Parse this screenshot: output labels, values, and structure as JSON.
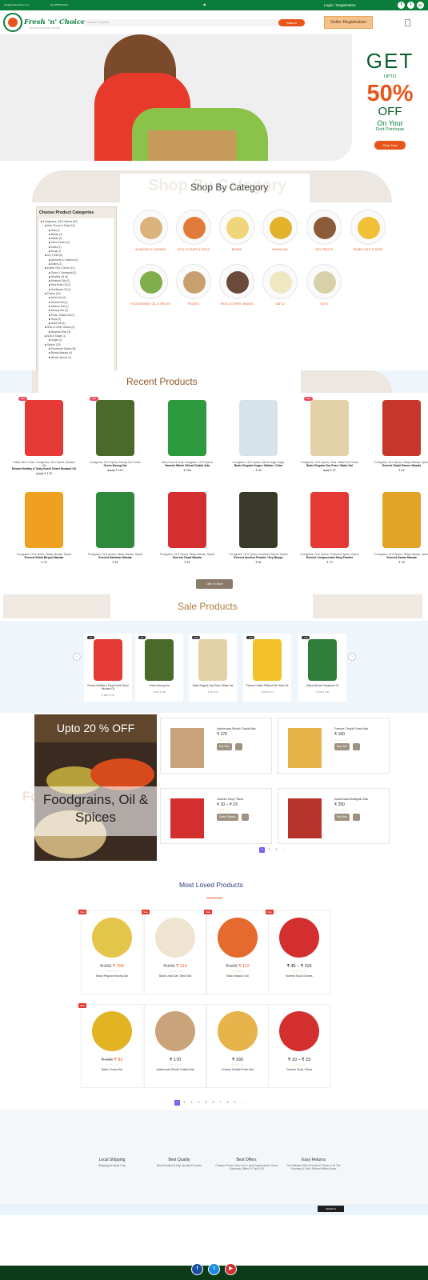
{
  "topbar": {
    "email": "info@freshnchoice.com",
    "phone": "+91 9876543210",
    "login_label": "Login / Registration",
    "social": [
      "f",
      "t",
      "G+"
    ]
  },
  "header": {
    "logo_name": "Fresh 'n' Choice",
    "logo_tagline": "ONLINE GROCERY STORE",
    "search_placeholder": "Search Products...",
    "search_button": "Search",
    "seller_button": "Seller Registration"
  },
  "hero": {
    "get": "GET",
    "upto": "UPTO",
    "percent": "50%",
    "off": "OFF",
    "on_your": "On Your",
    "first_purchase": "First Purchase",
    "shop_button": "Shop Now"
  },
  "category_section": {
    "ghost": "Shop By Category",
    "title": "Shop By Category",
    "sidebar_title": "Choose Product Categories",
    "tree": [
      "■ Foodgrains, Oil & Spices (67)",
      "  ■ Atta, Flours & Sooji (10)",
      "    ■ Atta (4)",
      "    ■ Besan (1)",
      "    ■ Maida (1)",
      "    ■ Other Flours (2)",
      "    ■ Sattu (1)",
      "    ■ Sooji (1)",
      "  ■ Dry Fruits (6)",
      "    ■ Almonds & Cashew (4)",
      "    ■ Dates (2)",
      "  ■ Edible Oils & Ghee (10)",
      "    ■ Ghee & Vanaspati (2)",
      "    ■ Healthy Oil (4)",
      "    ■ Mustard Oils (2)",
      "    ■ Rice Bran Oil (1)",
      "    ■ Sunflower Oil (1)",
      "  ■ Pulses (10)",
      "    ■ Arhar Dal (1)",
      "    ■ Chana Dal (1)",
      "    ■ Masoor Dal (1)",
      "    ■ Moong Dal (3)",
      "    ■ Peas / Matar Dal (1)",
      "    ■ Soya (2)",
      "    ■ Urad Dal (1)",
      "  ■ Rice & Other Grains (3)",
      "    ■ Basmati Rice (3)",
      "  ■ Salt & Sugar (1)",
      "    ■ Sugar (1)",
      "  ■ Spices (23)",
      "    ■ Powdered Spices (8)",
      "    ■ Ready Masala (4)",
      "    ■ Whole Spices (1)"
    ],
    "categories": [
      {
        "label": "ALMONDS & CASHEW",
        "color": "#d9b27c"
      },
      {
        "label": "ATTA, FLOURS & SOOJI",
        "color": "#e07a3a"
      },
      {
        "label": "BESAN",
        "color": "#f0d57a"
      },
      {
        "label": "CHANA DAL",
        "color": "#e3b12a"
      },
      {
        "label": "DRY FRUITS",
        "color": "#8a5a3a"
      },
      {
        "label": "EDIBLE OILS & GHEE",
        "color": "#f2c037"
      },
      {
        "label": "FOODGRAINS, OIL & SPICES",
        "color": "#7fae4a"
      },
      {
        "label": "PULSES",
        "color": "#c8a070"
      },
      {
        "label": "RICE & OTHER GRAINS",
        "color": "#6a4a3a"
      },
      {
        "label": "SATTU",
        "color": "#efe6c2"
      },
      {
        "label": "SOYA",
        "color": "#d8d0a8"
      }
    ]
  },
  "recent": {
    "title": "Recent Products",
    "click_more": "Click To More",
    "products": [
      {
        "badge": "Sale",
        "cat": "Edible Oils & Ghee, Foodgrains, Oil & Spices, Mustard Oils",
        "name": "Emami Healthy & Tasty Kachi Ghani Mustard Oil",
        "old": "₹ 180",
        "price": "₹ 175",
        "color": "#e53935"
      },
      {
        "badge": "Sale",
        "cat": "Foodgrains, Oil & Spices, Moong Dal, Pulses",
        "name": "Green Moong Dal",
        "old": "₹ 120",
        "price": "₹ 115",
        "color": "#4a6a2a"
      },
      {
        "badge": "",
        "cat": "Atta, Flours & Sooji, Foodgrains, Oil & Spices",
        "name": "Ganesh Whole Wheat Chakki Atta",
        "old": "",
        "price": "₹ 165",
        "color": "#2e9a3e"
      },
      {
        "badge": "",
        "cat": "Foodgrains, Oil & Spices, Salt & Sugar, Sugar",
        "name": "Basic Regular Sugar / Sakkar / Chini",
        "old": "",
        "price": "₹ 45",
        "color": "#d6e4ea"
      },
      {
        "badge": "Sale",
        "cat": "Foodgrains, Oil & Spices, Peas / Matar Dal, Pulses",
        "name": "Basic Regular Dry Peas / Matar Dal",
        "old": "₹ 45",
        "price": "₹ 37",
        "color": "#e3d2a8"
      },
      {
        "badge": "",
        "cat": "Foodgrains, Oil & Spices, Ready Masala, Spices",
        "name": "Everest Shahi Paneer Masala",
        "old": "",
        "price": "₹ 42",
        "color": "#c8352a"
      },
      {
        "badge": "",
        "cat": "Foodgrains, Oil & Spices, Ready Masala, Spices",
        "name": "Everest Shahi Biryani Masala",
        "old": "",
        "price": "₹ 70",
        "color": "#f0a020"
      },
      {
        "badge": "",
        "cat": "Foodgrains, Oil & Spices, Ready Masala, Spices",
        "name": "Everest Sambhar Masala",
        "old": "",
        "price": "₹ 63",
        "color": "#2e8a3a"
      },
      {
        "badge": "",
        "cat": "Foodgrains, Oil & Spices, Ready Masala, Spices",
        "name": "Everest Chaat Masala",
        "old": "",
        "price": "₹ 42",
        "color": "#d32f2f"
      },
      {
        "badge": "",
        "cat": "Foodgrains, Oil & Spices, Powdered Spices, Spices",
        "name": "Everest Amchur Powder / Dry Mango",
        "old": "",
        "price": "₹ 80",
        "color": "#3a3a2a"
      },
      {
        "badge": "",
        "cat": "Foodgrains, Oil & Spices, Powdered Spices, Spices",
        "name": "Everest Compounded Hing Powder",
        "old": "",
        "price": "₹ 70",
        "color": "#e53935"
      },
      {
        "badge": "",
        "cat": "Foodgrains, Oil & Spices, Ready Masala, Spices",
        "name": "Everest Garam Masala",
        "old": "",
        "price": "₹ 78",
        "color": "#e2a326"
      }
    ]
  },
  "sale": {
    "title": "Sale Products",
    "items": [
      {
        "badge": "-3%",
        "name": "Emami Healthy & Tasty Kachi Ghani Mustard Oil",
        "price": "₹ 180 ₹ 175",
        "color": "#e53935"
      },
      {
        "badge": "-4%",
        "name": "Green Moong Dal",
        "price": "₹ 120 ₹ 115",
        "color": "#4a6a2a"
      },
      {
        "badge": "-18%",
        "name": "Basic Regular Dry Peas / Matar Dal",
        "price": "₹ 45 ₹ 37",
        "color": "#e3d2a8"
      },
      {
        "badge": "-12%",
        "name": "Fortune Health Refined Rice Bran Oil",
        "price": "₹ 195 ₹ 171",
        "color": "#f3c12a"
      },
      {
        "badge": "-13%",
        "name": "King's Refined Soyabean Oil",
        "price": "₹ 150 ₹ 130",
        "color": "#2f7d3a"
      }
    ]
  },
  "promo": {
    "upto": "Upto 20 % OFF",
    "name": "Foodgrains, Oil & Spices",
    "ghost": "Fo",
    "products": [
      {
        "name": "Aashirvaad Shudh Chakki Atta",
        "price": "₹ 170",
        "button": "Buy Now",
        "color": "#c9a37a"
      },
      {
        "name": "Fortune Chakki Fresh Atta",
        "price": "₹ 160",
        "button": "Buy Now",
        "color": "#e6b44a"
      },
      {
        "name": "Ganesh Sooji / Rava",
        "price": "₹ 10 – ₹ 23",
        "button": "Select Options",
        "color": "#d32f2f"
      },
      {
        "name": "Aashirvaad Multigrain Atta",
        "price": "₹ 250",
        "button": "Buy Now",
        "color": "#b7342a"
      }
    ],
    "pages": [
      "1",
      "2",
      "3",
      "→"
    ]
  },
  "most_loved": {
    "title": "Most Loved Products",
    "products": [
      {
        "sale": "Sale",
        "old": "₹ 160",
        "price": "₹ 150",
        "name": "Basic Regular Moong Dal",
        "color": "#e3c54a"
      },
      {
        "sale": "Sale",
        "old": "₹ 140",
        "price": "₹ 115",
        "name": "Basic Urad Dal / Beuli Dal",
        "color": "#eee4d0"
      },
      {
        "sale": "Sale",
        "old": "₹ 120",
        "price": "₹ 112",
        "name": "Basic Masoor Dal",
        "color": "#e46a2e"
      },
      {
        "sale": "Sale",
        "old": "",
        "price": "₹ 45 – ₹ 115",
        "name": "Nutrela Soya Chunks",
        "color": "#d32f2f"
      },
      {
        "sale": "Sale",
        "old": "₹ 120",
        "price": "₹ 82",
        "name": "Basic Chana Dal",
        "color": "#e2b424"
      },
      {
        "sale": "",
        "old": "",
        "price": "₹ 170",
        "name": "Aashirvaad Shudh Chakki Atta",
        "color": "#c9a37a"
      },
      {
        "sale": "",
        "old": "",
        "price": "₹ 160",
        "name": "Fortune Chakki Fresh Atta",
        "color": "#e6b44a"
      },
      {
        "sale": "",
        "old": "",
        "price": "₹ 10 – ₹ 23",
        "name": "Ganesh Sooji / Rava",
        "color": "#d32f2f"
      }
    ],
    "pages": [
      "1",
      "2",
      "3",
      "4",
      "5",
      "6",
      "7",
      "8",
      "9",
      "→"
    ]
  },
  "features": [
    {
      "title": "Local Shipping",
      "desc": "Shipping At Nadia Only"
    },
    {
      "title": "Best Quality",
      "desc": "Best Branded & High Quality Products"
    },
    {
      "title": "Best Offers",
      "desc": "Cheaper Prices Than Your Local Supermarket, Great Cashback Offers To Top It Off"
    },
    {
      "title": "Easy Returns",
      "desc": "Not Satisfied With A Product? Return It At The Doorstep & Get A Refund Within Hours"
    }
  ],
  "band_button": "SEARCH",
  "footer_social": [
    "f",
    "t",
    "▶"
  ],
  "stars": "☆☆☆☆☆"
}
